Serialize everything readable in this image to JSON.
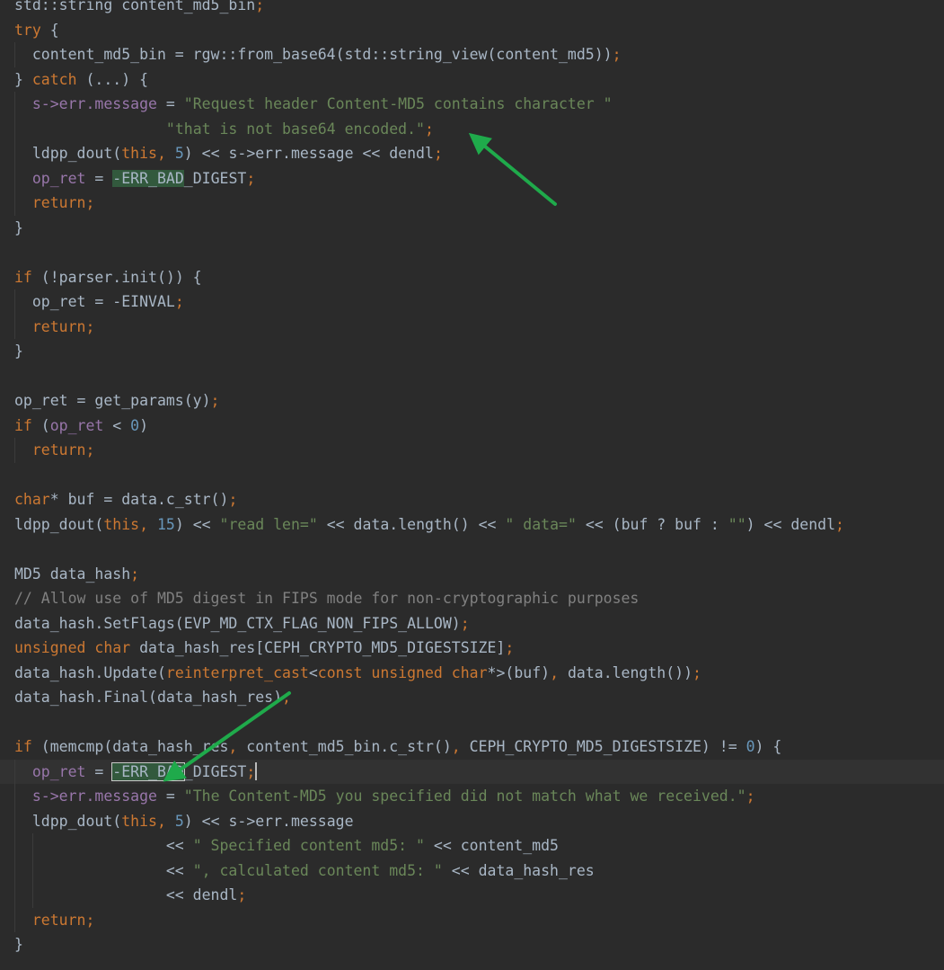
{
  "editor": {
    "colors": {
      "background": "#2b2b2b",
      "keyword": "#cc7832",
      "string": "#6a8759",
      "number": "#6897bb",
      "comment": "#808080",
      "field": "#9876aa",
      "highlight": "#32593d",
      "annotation_arrow": "#1faa4b"
    },
    "lines": [
      [
        [
          "t",
          "std::string content_md5_bin"
        ],
        [
          "k",
          ";"
        ]
      ],
      [
        [
          "k",
          "try"
        ],
        [
          "t",
          " {"
        ]
      ],
      [
        [
          "t",
          "  content_md5_bin = rgw::from_base64(std::string_view(content_md5))"
        ],
        [
          "k",
          ";"
        ]
      ],
      [
        [
          "t",
          "} "
        ],
        [
          "k",
          "catch"
        ],
        [
          "t",
          " (...) {"
        ]
      ],
      [
        [
          "t",
          "  "
        ],
        [
          "f",
          "s->err.message"
        ],
        [
          "t",
          " = "
        ],
        [
          "s",
          "\"Request header Content-MD5 contains character \""
        ]
      ],
      [
        [
          "t",
          "                 "
        ],
        [
          "s",
          "\"that is not base64 encoded.\""
        ],
        [
          "k",
          ";"
        ]
      ],
      [
        [
          "t",
          "  ldpp_dout("
        ],
        [
          "k",
          "this"
        ],
        [
          "k",
          ", "
        ],
        [
          "n",
          "5"
        ],
        [
          "t",
          ") << s->err.message << dendl"
        ],
        [
          "k",
          ";"
        ]
      ],
      [
        [
          "t",
          "  "
        ],
        [
          "f",
          "op_ret"
        ],
        [
          "t",
          " = "
        ],
        [
          "h",
          "-ERR_BAD"
        ],
        [
          "t",
          "_DIGEST"
        ],
        [
          "k",
          ";"
        ]
      ],
      [
        [
          "t",
          "  "
        ],
        [
          "k",
          "return;"
        ]
      ],
      [
        [
          "t",
          "}"
        ]
      ],
      [],
      [
        [
          "k",
          "if"
        ],
        [
          "t",
          " (!parser.init()) {"
        ]
      ],
      [
        [
          "t",
          "  op_ret = -EINVAL"
        ],
        [
          "k",
          ";"
        ]
      ],
      [
        [
          "t",
          "  "
        ],
        [
          "k",
          "return;"
        ]
      ],
      [
        [
          "t",
          "}"
        ]
      ],
      [],
      [
        [
          "t",
          "op_ret = get_params(y)"
        ],
        [
          "k",
          ";"
        ]
      ],
      [
        [
          "k",
          "if"
        ],
        [
          "t",
          " ("
        ],
        [
          "f",
          "op_ret"
        ],
        [
          "t",
          " < "
        ],
        [
          "n",
          "0"
        ],
        [
          "t",
          ")"
        ]
      ],
      [
        [
          "t",
          "  "
        ],
        [
          "k",
          "return;"
        ]
      ],
      [],
      [
        [
          "k",
          "char"
        ],
        [
          "t",
          "* buf = data.c_str()"
        ],
        [
          "k",
          ";"
        ]
      ],
      [
        [
          "t",
          "ldpp_dout("
        ],
        [
          "k",
          "this"
        ],
        [
          "k",
          ", "
        ],
        [
          "n",
          "15"
        ],
        [
          "t",
          ") << "
        ],
        [
          "s",
          "\"read len=\""
        ],
        [
          "t",
          " << data.length() << "
        ],
        [
          "s",
          "\" data=\""
        ],
        [
          "t",
          " << (buf ? buf : "
        ],
        [
          "s",
          "\"\""
        ],
        [
          "t",
          ") << dendl"
        ],
        [
          "k",
          ";"
        ]
      ],
      [],
      [
        [
          "t",
          "MD5 data_hash"
        ],
        [
          "k",
          ";"
        ]
      ],
      [
        [
          "c",
          "// Allow use of MD5 digest in FIPS mode for non-cryptographic purposes"
        ]
      ],
      [
        [
          "t",
          "data_hash.SetFlags(EVP_MD_CTX_FLAG_NON_FIPS_ALLOW)"
        ],
        [
          "k",
          ";"
        ]
      ],
      [
        [
          "k",
          "unsigned char"
        ],
        [
          "t",
          " data_hash_res[CEPH_CRYPTO_MD5_DIGESTSIZE]"
        ],
        [
          "k",
          ";"
        ]
      ],
      [
        [
          "t",
          "data_hash.Update("
        ],
        [
          "k",
          "reinterpret_cast"
        ],
        [
          "t",
          "<"
        ],
        [
          "k",
          "const unsigned char"
        ],
        [
          "t",
          "*>(buf)"
        ],
        [
          "k",
          ", "
        ],
        [
          "t",
          "data.length())"
        ],
        [
          "k",
          ";"
        ]
      ],
      [
        [
          "t",
          "data_hash.Final(data_hash_res)"
        ],
        [
          "k",
          ";"
        ]
      ],
      [],
      [
        [
          "k",
          "if"
        ],
        [
          "t",
          " (memcmp(data_hash_res"
        ],
        [
          "k",
          ", "
        ],
        [
          "t",
          "content_md5_bin.c_str()"
        ],
        [
          "k",
          ", "
        ],
        [
          "t",
          "CEPH_CRYPTO_MD5_DIGESTSIZE) != "
        ],
        [
          "n",
          "0"
        ],
        [
          "t",
          ") {"
        ]
      ],
      [
        [
          "t",
          "  "
        ],
        [
          "f",
          "op_ret"
        ],
        [
          "t",
          " = "
        ],
        [
          "b",
          "-ERR_BAD"
        ],
        [
          "t",
          "_DIGEST"
        ],
        [
          "k",
          ";"
        ],
        [
          "cursor",
          ""
        ]
      ],
      [
        [
          "t",
          "  "
        ],
        [
          "f",
          "s->err.message"
        ],
        [
          "t",
          " = "
        ],
        [
          "s",
          "\"The Content-MD5 you specified did not match what we received.\""
        ],
        [
          "k",
          ";"
        ]
      ],
      [
        [
          "t",
          "  ldpp_dout("
        ],
        [
          "k",
          "this"
        ],
        [
          "k",
          ", "
        ],
        [
          "n",
          "5"
        ],
        [
          "t",
          ") << s->err.message"
        ]
      ],
      [
        [
          "t",
          "                 << "
        ],
        [
          "s",
          "\" Specified content md5: \""
        ],
        [
          "t",
          " << content_md5"
        ]
      ],
      [
        [
          "t",
          "                 << "
        ],
        [
          "s",
          "\", calculated content md5: \""
        ],
        [
          "t",
          " << data_hash_res"
        ]
      ],
      [
        [
          "t",
          "                 << dendl"
        ],
        [
          "k",
          ";"
        ]
      ],
      [
        [
          "t",
          "  "
        ],
        [
          "k",
          "return;"
        ]
      ],
      [
        [
          "t",
          "}"
        ]
      ]
    ],
    "current_line": 31
  }
}
